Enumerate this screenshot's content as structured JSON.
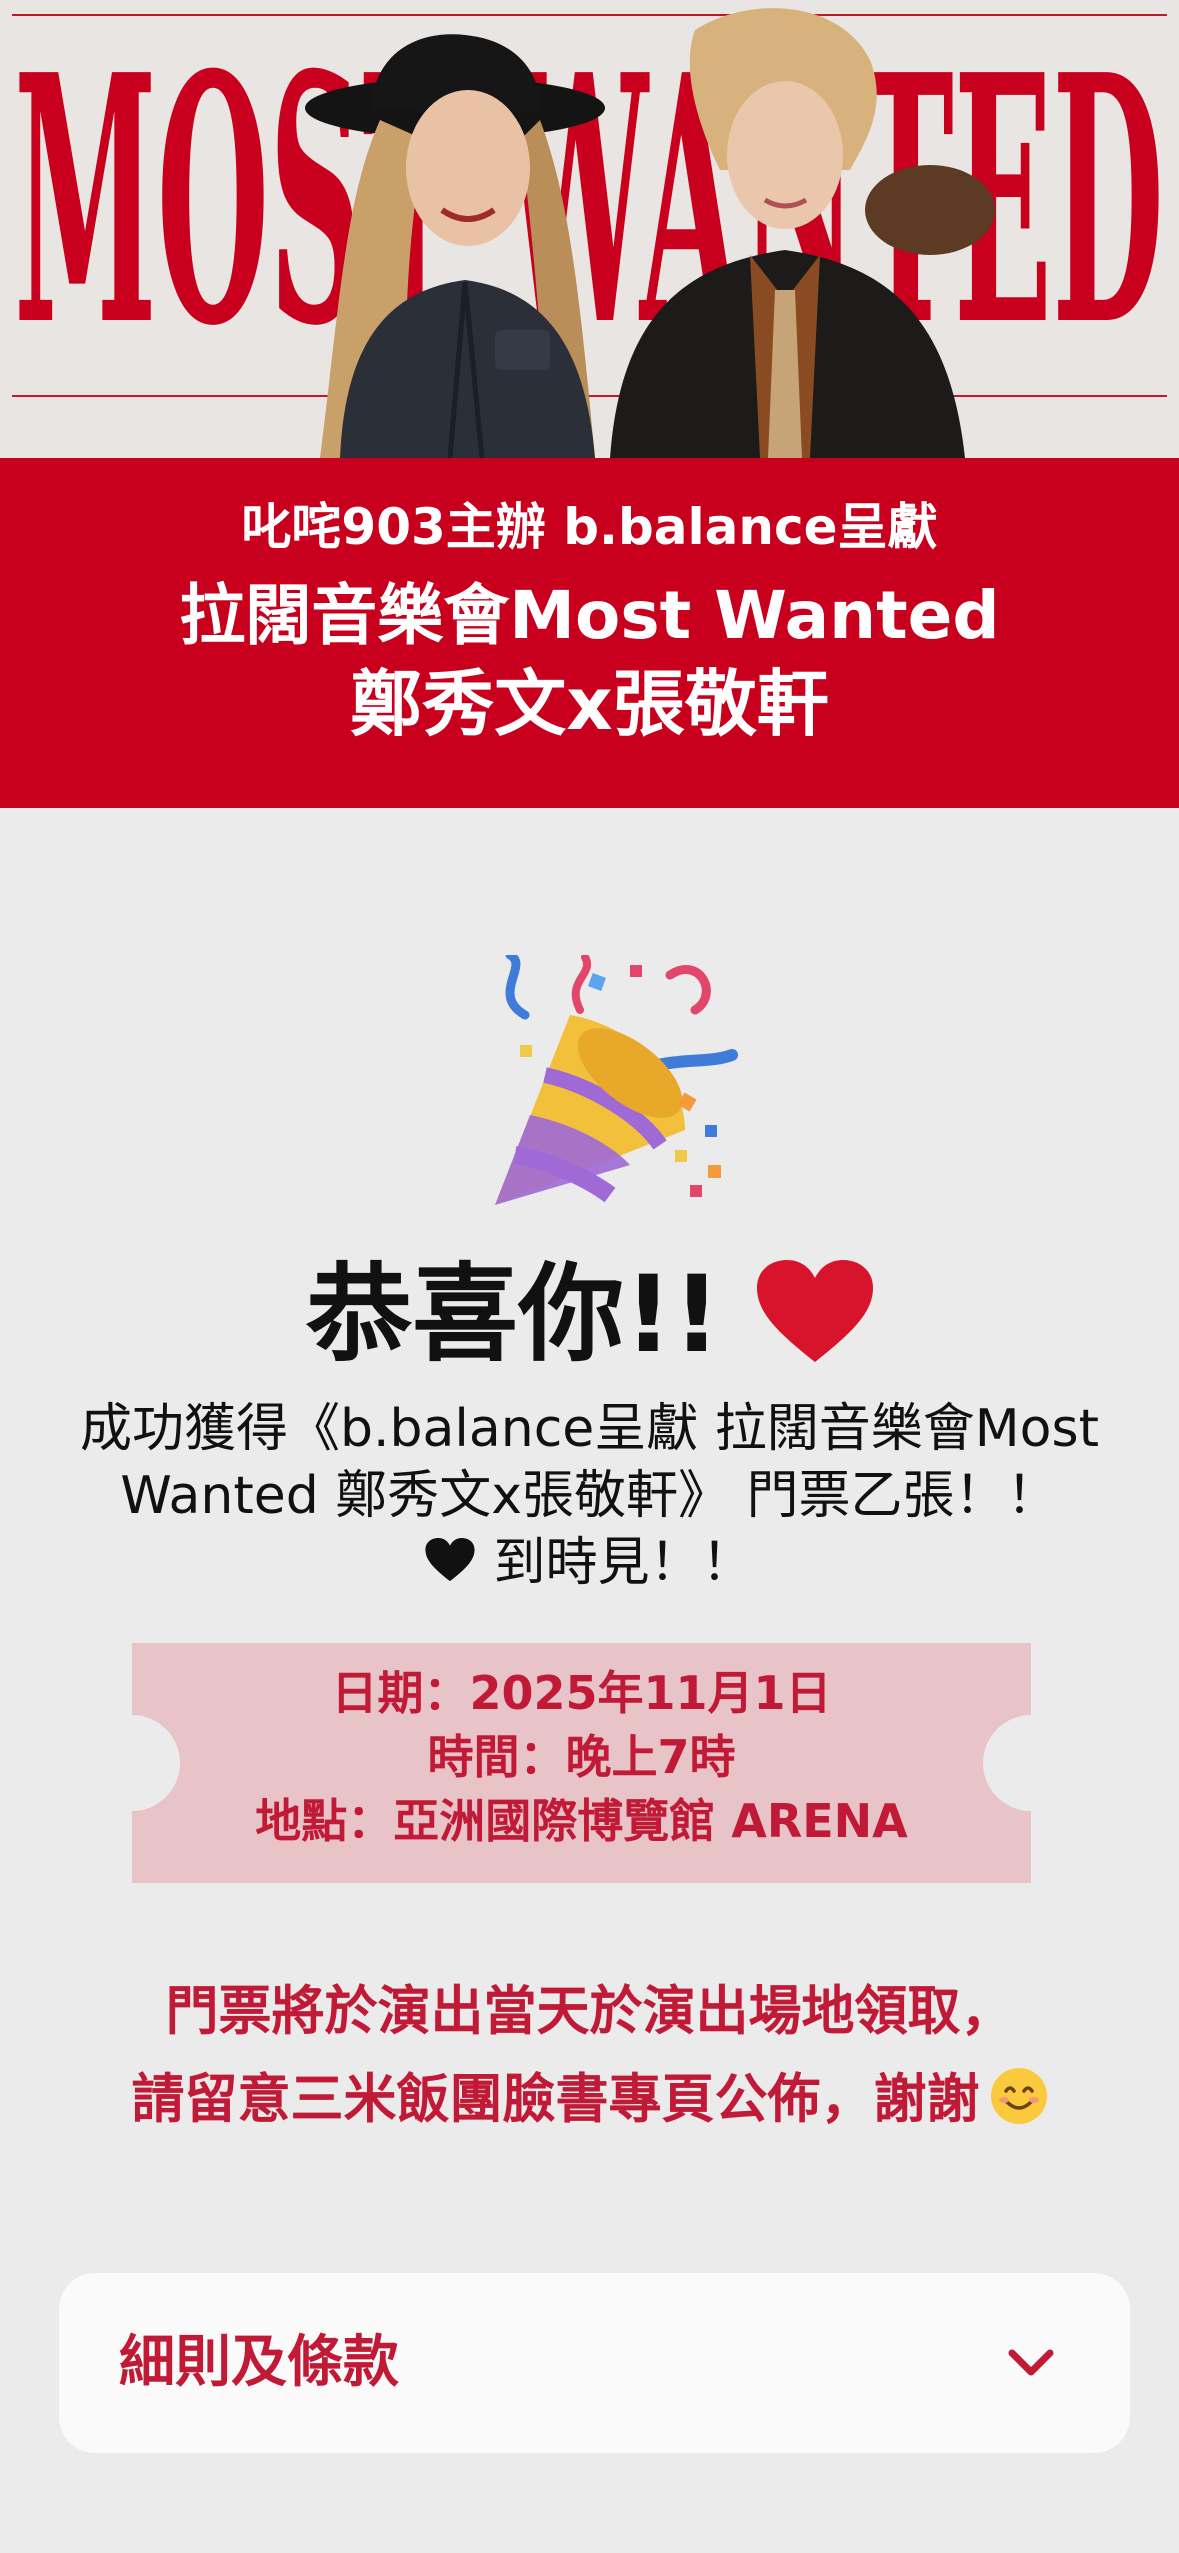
{
  "hero": {
    "banner_text": "MOST WANTED"
  },
  "title_band": {
    "presenter_line": "叱咤903主辦 b.balance呈獻",
    "main_line": "拉闊音樂會Most Wanted",
    "artists_line": "鄭秀文x張敬軒"
  },
  "congrats": {
    "headline": "恭喜你!!",
    "message": "成功獲得《b.balance呈獻 拉闊音樂會Most Wanted 鄭秀文x張敬軒》 門票乙張！！",
    "see_you": "到時見！！"
  },
  "ticket": {
    "date": "日期：2025年11月1日",
    "time": "時間：晚上7時",
    "venue": "地點：亞洲國際博覽館 ARENA"
  },
  "notice": {
    "line1": "門票將於演出當天於演出場地領取，",
    "line2": "請留意三米飯團臉書專頁公佈，謝謝"
  },
  "terms": {
    "label": "細則及條款"
  },
  "icons": {
    "heart": "heart-icon",
    "party_popper": "party-popper-icon",
    "smile": "smiling-face-icon",
    "chevron": "chevron-down-icon"
  },
  "colors": {
    "brand_red": "#c8001e",
    "text_red": "#c11a36",
    "ticket_pink": "#e8c4c8",
    "page_bg": "#ebebeb",
    "card_bg": "#fafafa"
  }
}
